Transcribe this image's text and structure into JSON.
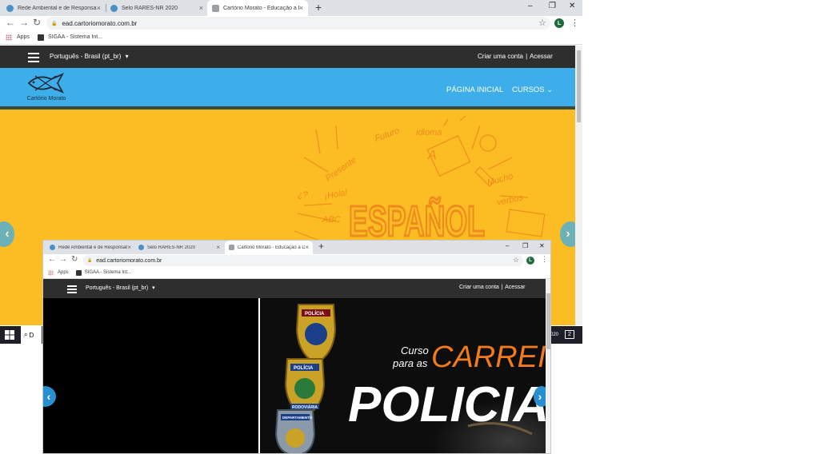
{
  "browser": {
    "tabs": [
      {
        "title": "Rede Ambiental e de Responsabili",
        "close": "×"
      },
      {
        "title": "Selo RARES-NR 2020",
        "close": "×"
      },
      {
        "title": "Cartório Morato - Educação a Di",
        "close": "×"
      }
    ],
    "tabs_small": [
      {
        "title": "Rede Ambiental e de Responsabili",
        "close": "×"
      },
      {
        "title": "Selo RARES-NR 2020",
        "close": "×"
      },
      {
        "title": "Cartório Morato - Educação a Di",
        "close": "×"
      }
    ],
    "new_tab": "+",
    "minimize": "–",
    "restore": "❐",
    "close": "✕",
    "back": "←",
    "forward": "→",
    "reload": "↻",
    "lock": "🔒",
    "url": "ead.cartoriomorato.com.br",
    "star": "☆",
    "profile_initial": "L",
    "menu": "⋮",
    "bookmarks": [
      {
        "label": "Apps",
        "icon": "apps-grid-icon"
      },
      {
        "label": "SIGAA - Sistema Int...",
        "icon": "sigaa-icon"
      }
    ]
  },
  "site": {
    "language": "Português - Brasil (pt_br)",
    "caret": "▾",
    "create_account": "Criar uma conta",
    "separator": "|",
    "login": "Acessar",
    "logo_text": "Cartório Morato",
    "nav_home": "PÁGINA INICIAL",
    "nav_courses": "CURSOS",
    "nav_caret": "⌄",
    "prev": "‹",
    "next": "›"
  },
  "hero_espanol": {
    "title": "ESPAÑOL",
    "doodles": [
      "Futuro",
      "idioma",
      "Presente",
      "ABC",
      "¡Hola!",
      "Mucho",
      "verbos",
      "¿?",
      "A"
    ]
  },
  "hero_policia": {
    "line1": "Curso",
    "line2": "para as",
    "highlight": "CARREIR",
    "big": "POLICIA",
    "badges": [
      "POLÍCIA",
      "POLÍCIA",
      "RODOVIÁRIA",
      "DEPARTAMENTO"
    ]
  },
  "taskbar": {
    "search_letter": "D",
    "clock": "020",
    "notif": "2"
  },
  "colors": {
    "accent_blue": "#3daee9",
    "hero_yellow": "#fbbd23",
    "hero_orange": "#f08a1c",
    "dark_bar": "#2e2e2e"
  }
}
